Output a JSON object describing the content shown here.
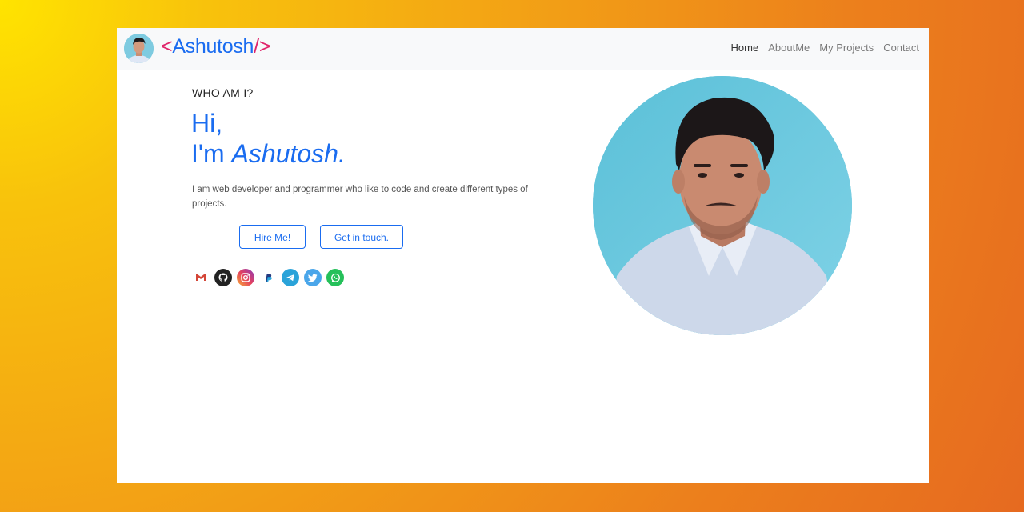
{
  "brand": {
    "open": "<",
    "name": "Ashutosh",
    "close": "/>"
  },
  "nav": {
    "home": "Home",
    "about": "AboutMe",
    "projects": "My Projects",
    "contact": "Contact"
  },
  "hero": {
    "eyebrow": "WHO AM I?",
    "greeting": "Hi,",
    "intro_prefix": "I'm ",
    "intro_name": "Ashutosh.",
    "description": "I am web developer and programmer who like to code and create different types of projects.",
    "hire_button": "Hire Me!",
    "touch_button": "Get in touch."
  },
  "socials": [
    {
      "icon": "gmail-icon"
    },
    {
      "icon": "github-icon"
    },
    {
      "icon": "instagram-icon"
    },
    {
      "icon": "paypal-icon"
    },
    {
      "icon": "telegram-icon"
    },
    {
      "icon": "twitter-icon"
    },
    {
      "icon": "whatsapp-icon"
    }
  ],
  "colors": {
    "accent": "#1a6cf0",
    "brand_bracket": "#e0246a"
  }
}
